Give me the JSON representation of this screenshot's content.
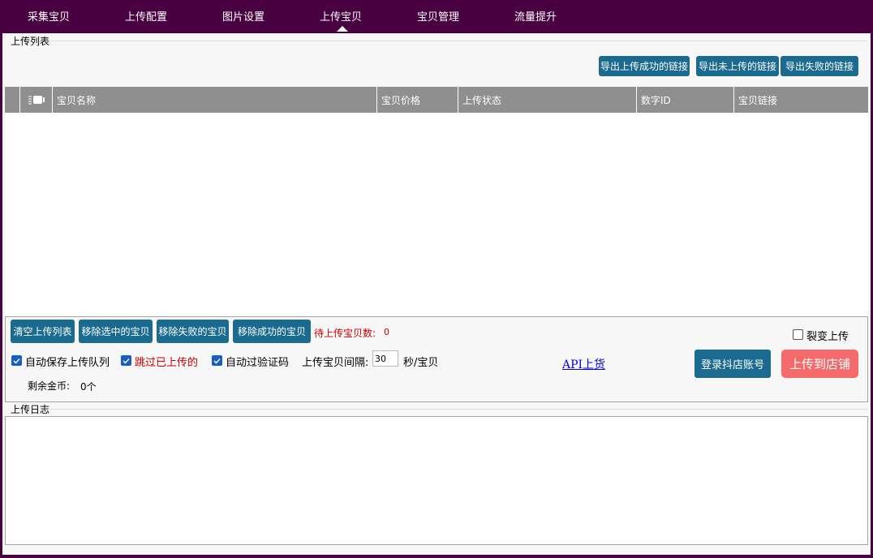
{
  "nav": {
    "tabs": [
      "采集宝贝",
      "上传配置",
      "图片设置",
      "上传宝贝",
      "宝贝管理",
      "流量提升"
    ],
    "active_index": 3
  },
  "upload_list": {
    "title": "上传列表",
    "export_buttons": [
      "导出上传成功的链接",
      "导出未上传的链接",
      "导出失败的链接"
    ],
    "columns": [
      "",
      "",
      "宝贝名称",
      "宝贝价格",
      "上传状态",
      "数字ID",
      "宝贝链接"
    ],
    "rows": []
  },
  "controls": {
    "action_buttons": [
      "清空上传列表",
      "移除选中的宝贝",
      "移除失败的宝贝",
      "移除成功的宝贝"
    ],
    "pending_label": "待上传宝贝数:",
    "pending_count": "0",
    "fission_label": "裂变上传",
    "fission_checked": false,
    "auto_save_label": "自动保存上传队列",
    "auto_save_checked": true,
    "skip_uploaded_label": "跳过已上传的",
    "skip_uploaded_checked": true,
    "auto_captcha_label": "自动过验证码",
    "auto_captcha_checked": true,
    "interval_label": "上传宝贝间隔:",
    "interval_value": "30",
    "interval_unit": "秒/宝贝",
    "api_link": "API上货",
    "login_button": "登录抖店账号",
    "upload_button": "上传到店铺",
    "coins_label": "剩余金币:",
    "coins_value": "0个"
  },
  "log": {
    "title": "上传日志",
    "content": ""
  },
  "colors": {
    "background": "#480040",
    "panel": "#f7f7f7",
    "button_blue": "#1a6b8f",
    "upload_button": "#f46a6a",
    "pending_red": "#cc0000",
    "header_gray": "#8f8f8f"
  }
}
